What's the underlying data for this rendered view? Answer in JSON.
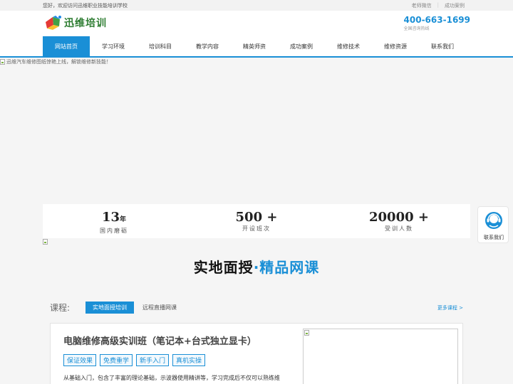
{
  "topbar": {
    "welcome": "您好，欢迎访问迅维职业技能培训学校",
    "links": [
      "老师微信",
      "成功案例"
    ]
  },
  "header": {
    "logo_text": "迅维培训",
    "hotline_number": "400-663-1699",
    "hotline_label": "全国咨询热线"
  },
  "nav": {
    "items": [
      "网站首页",
      "学习环境",
      "培训科目",
      "教学内容",
      "精英师资",
      "成功案例",
      "维修技术",
      "维修资源",
      "联系我们"
    ],
    "active_index": 0
  },
  "banner": {
    "alt_text": "迅维汽车维修图纸惊艳上线，解锁维修新技能！"
  },
  "stats": [
    {
      "value": "13",
      "unit": "年",
      "label": "国内磨砺"
    },
    {
      "value": "500 +",
      "unit": "",
      "label": "开设班次"
    },
    {
      "value": "20000 +",
      "unit": "",
      "label": "受训人数"
    }
  ],
  "headline": {
    "part1": "实地面授",
    "part2": "·精品网课"
  },
  "courses": {
    "label": "课程:",
    "tabs": [
      "实地面授培训",
      "远程直播网课"
    ],
    "active_tab": 0,
    "more": "更多课程 >"
  },
  "card": {
    "title": "电脑维修高级实训班（笔记本+台式独立显卡）",
    "tags": [
      "保证效果",
      "免费重学",
      "新手入门",
      "真机实操"
    ],
    "description": "从基础入门，包含了丰富的理论基础，示波器使用精讲等，学习完成后不仅可以熟练维"
  },
  "float_contact": {
    "label": "联系我们"
  },
  "colors": {
    "accent": "#1a8fd6",
    "logo_green": "#2e7d32"
  }
}
